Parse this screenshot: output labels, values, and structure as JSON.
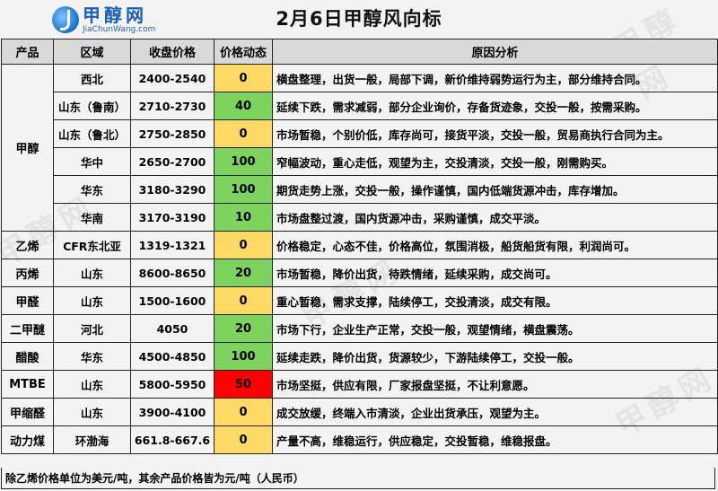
{
  "logo": {
    "name_cn": "甲醇网",
    "domain": "JiaChunWang.com"
  },
  "title": "2月6日甲醇风向标",
  "watermark_text": "甲醇网",
  "headers": [
    "产品",
    "区域",
    "收盘价格",
    "价格动态",
    "原因分析"
  ],
  "colors": {
    "green": "#7dd35e",
    "yellow": "#ffd966",
    "red": "#ff0000",
    "header_bg": "#d9d9d9"
  },
  "rows": [
    {
      "product": "甲醇",
      "region": "西北",
      "price": "2400-2540",
      "change": "0",
      "level": "yellow",
      "reason": "横盘整理，出货一般，局部下调，新价维持弱势运行为主，部分维持合同。"
    },
    {
      "product": "",
      "region": "山东（鲁南）",
      "price": "2710-2730",
      "change": "40",
      "level": "green",
      "reason": "延续下跌，需求减弱，部分企业询价，存备货迹象，交投一般，按需采购。"
    },
    {
      "product": "",
      "region": "山东（鲁北）",
      "price": "2750-2850",
      "change": "0",
      "level": "yellow",
      "reason": "市场暂稳，个别价低，库存尚可，接货平淡，交投一般，贸易商执行合同为主。"
    },
    {
      "product": "",
      "region": "华中",
      "price": "2650-2700",
      "change": "100",
      "level": "green",
      "reason": "窄幅波动，重心走低，观望为主，交投清淡，交投一般，刚需购买。"
    },
    {
      "product": "",
      "region": "华东",
      "price": "3180-3290",
      "change": "100",
      "level": "green",
      "reason": "期货走势上涨，交投一般，操作谨慎，国内低端货源冲击，库存增加。"
    },
    {
      "product": "",
      "region": "华南",
      "price": "3170-3190",
      "change": "10",
      "level": "green",
      "reason": "市场盘整过渡，国内货源冲击，采购谨慎，成交平淡。"
    },
    {
      "product": "乙烯",
      "region": "CFR东北亚",
      "price": "1319-1321",
      "change": "0",
      "level": "yellow",
      "reason": "价格稳定，心态不佳，价格高位，氛围消极，船货船货有限，利润尚可。"
    },
    {
      "product": "丙烯",
      "region": "山东",
      "price": "8600-8650",
      "change": "20",
      "level": "green",
      "reason": "市场暂稳，降价出货，待跌情绪，延续采购，成交尚可。"
    },
    {
      "product": "甲醛",
      "region": "山东",
      "price": "1500-1600",
      "change": "0",
      "level": "yellow",
      "reason": "重心暂稳，需求支撑，陆续停工，交投清淡，成交有限。"
    },
    {
      "product": "二甲醚",
      "region": "河北",
      "price": "4050",
      "change": "20",
      "level": "green",
      "reason": "市场下行，企业生产正常，交投一般，观望情绪，横盘震荡。"
    },
    {
      "product": "醋酸",
      "region": "华东",
      "price": "4500-4850",
      "change": "100",
      "level": "green",
      "reason": "延续走跌，降价出货，货源较少，下游陆续停工，交投一般。"
    },
    {
      "product": "MTBE",
      "region": "山东",
      "price": "5800-5950",
      "change": "50",
      "level": "red",
      "reason": "市场坚挺，供应有限，厂家报盘坚挺，不让利意愿。"
    },
    {
      "product": "甲缩醛",
      "region": "山东",
      "price": "3900-4100",
      "change": "0",
      "level": "yellow",
      "reason": "成交放缓，终端入市清淡，企业出货承压，观望为主。"
    },
    {
      "product": "动力煤",
      "region": "环渤海",
      "price": "661.8-667.6",
      "change": "0",
      "level": "yellow",
      "reason": "产量不高，维稳运行，供应稳定，交投暂稳，维稳报盘。"
    }
  ],
  "footer_note": "除乙烯价格单位为美元/吨，其余产品价格皆为元/吨（人民币）"
}
